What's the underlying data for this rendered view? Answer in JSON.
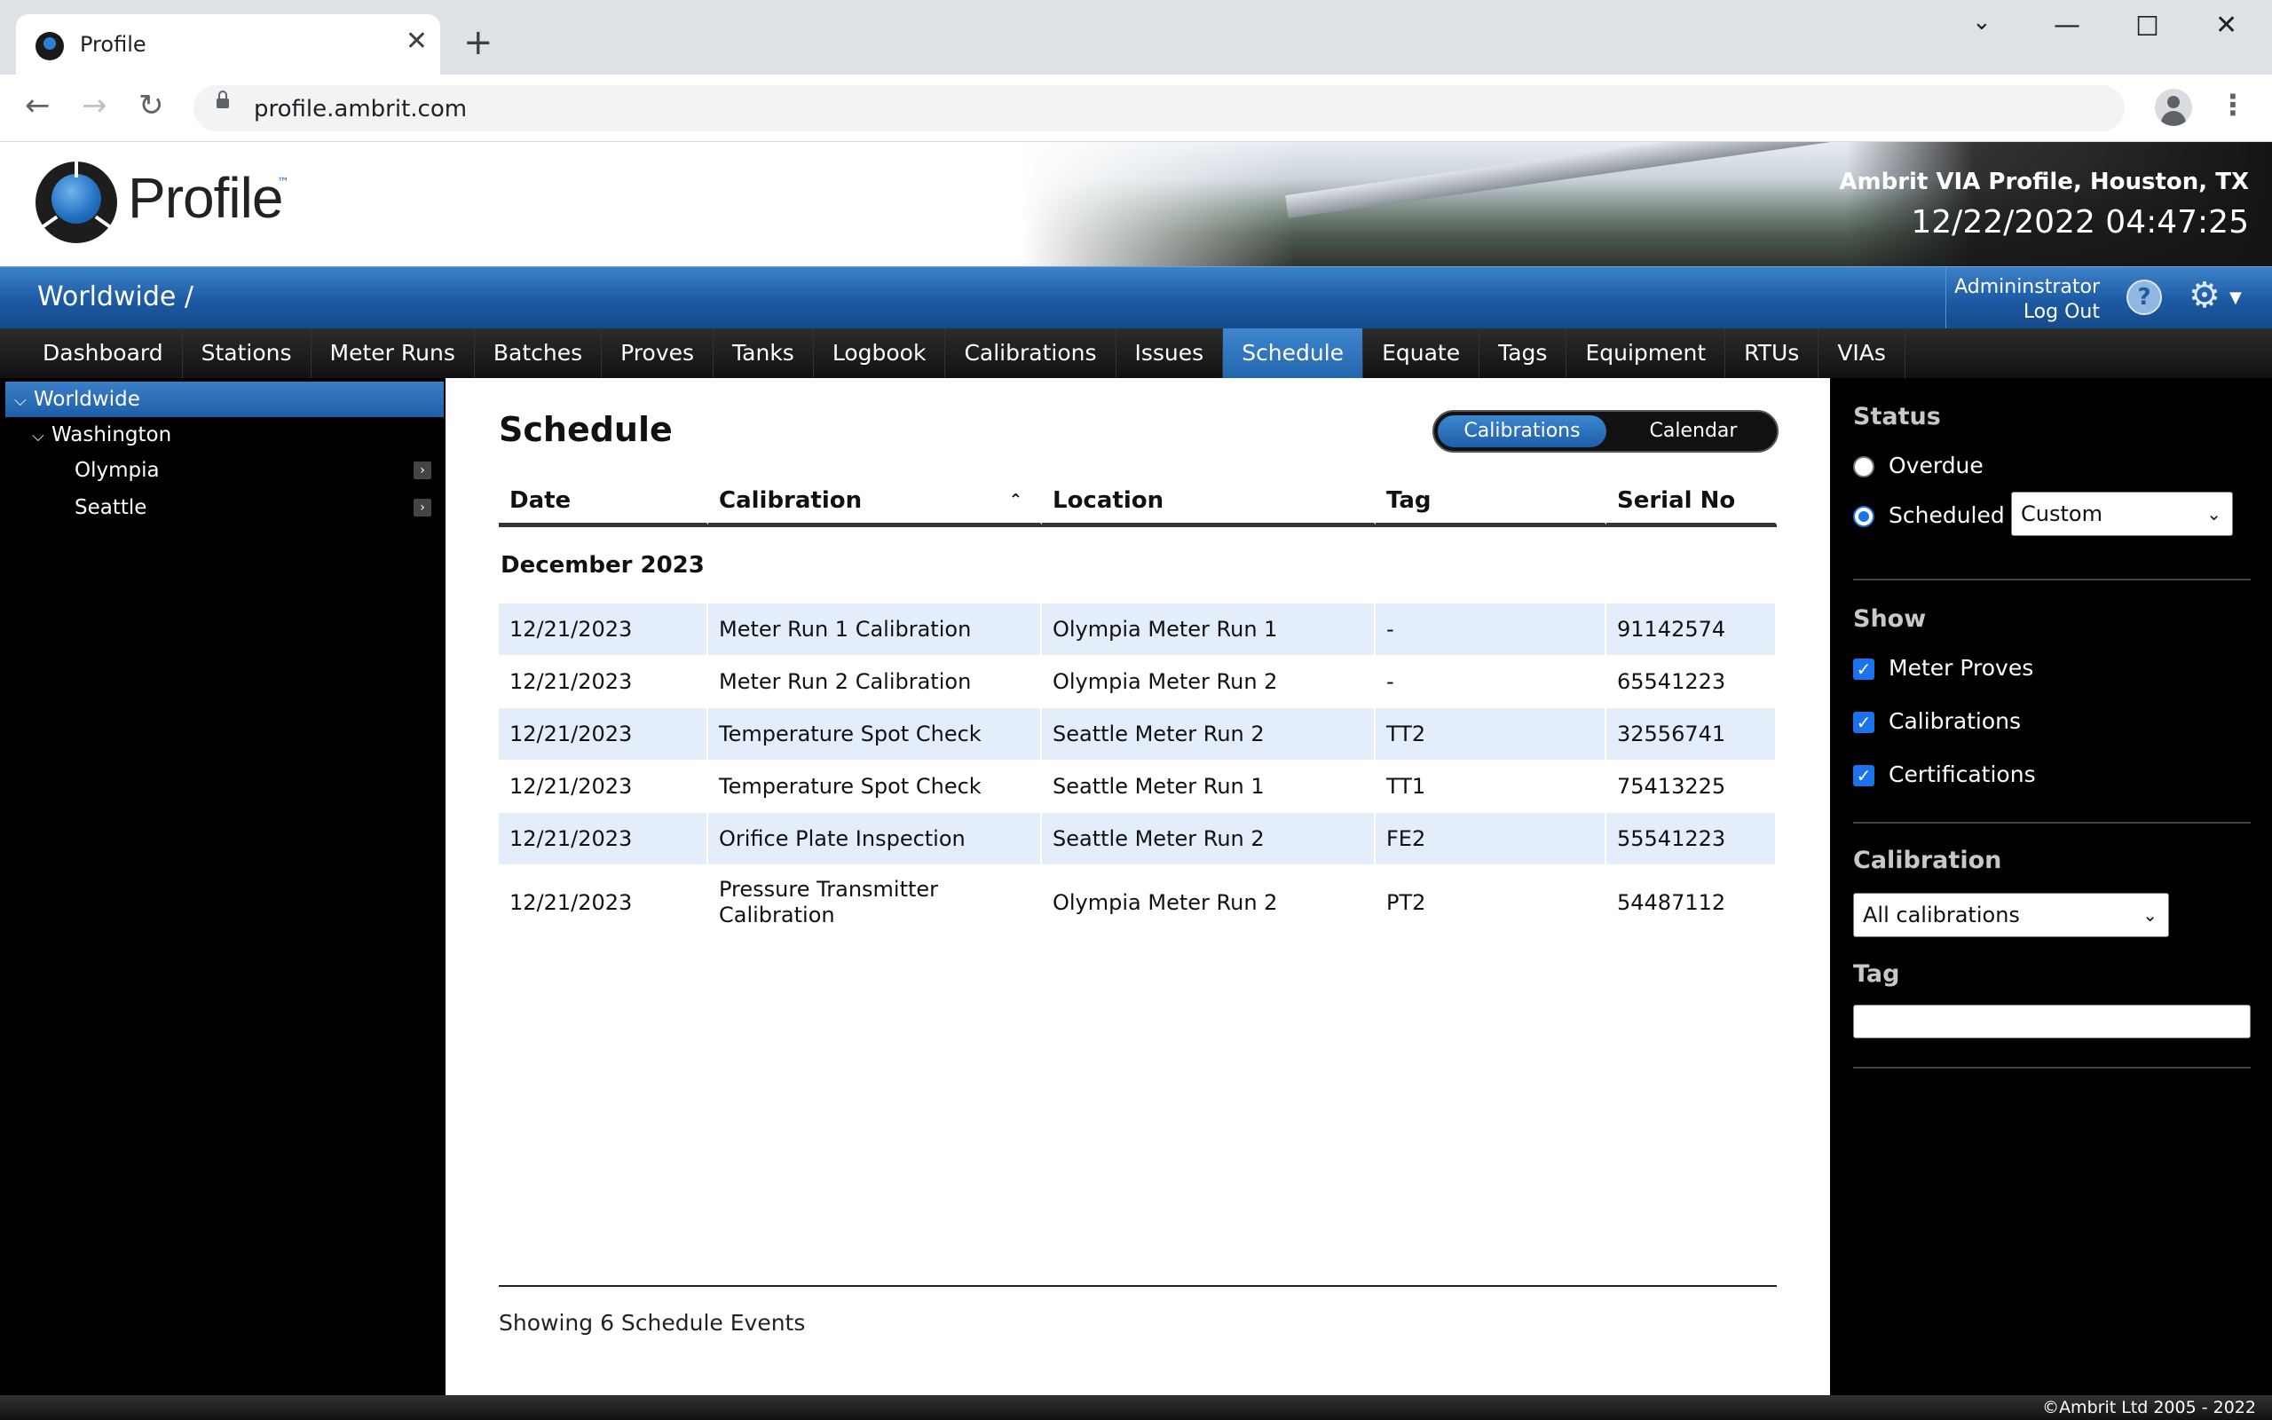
{
  "browser": {
    "tab_title": "Profile",
    "url": "profile.ambrit.com"
  },
  "header": {
    "logo_text": "Profile",
    "logo_tm": "™",
    "site_name": "Ambrit VIA Profile, Houston, TX",
    "datetime": "12/22/2022 04:47:25"
  },
  "bluebar": {
    "breadcrumb": "Worldwide /",
    "user": "Admininstrator",
    "logout": "Log Out",
    "help": "?"
  },
  "nav": {
    "items": [
      "Dashboard",
      "Stations",
      "Meter Runs",
      "Batches",
      "Proves",
      "Tanks",
      "Logbook",
      "Calibrations",
      "Issues",
      "Schedule",
      "Equate",
      "Tags",
      "Equipment",
      "RTUs",
      "VIAs"
    ],
    "active": "Schedule"
  },
  "tree": {
    "root": "Worldwide",
    "region": "Washington",
    "sites": [
      "Olympia",
      "Seattle"
    ]
  },
  "main": {
    "title": "Schedule",
    "toggle": {
      "calibrations": "Calibrations",
      "calendar": "Calendar"
    },
    "columns": {
      "date": "Date",
      "calibration": "Calibration",
      "location": "Location",
      "tag": "Tag",
      "serial": "Serial No"
    },
    "group": "December 2023",
    "rows": [
      {
        "date": "12/21/2023",
        "calibration": "Meter Run 1 Calibration",
        "location": "Olympia Meter Run 1",
        "tag": "-",
        "serial": "91142574"
      },
      {
        "date": "12/21/2023",
        "calibration": "Meter Run 2 Calibration",
        "location": "Olympia Meter Run 2",
        "tag": "-",
        "serial": "65541223"
      },
      {
        "date": "12/21/2023",
        "calibration": "Temperature Spot Check",
        "location": "Seattle Meter Run 2",
        "tag": "TT2",
        "serial": "32556741"
      },
      {
        "date": "12/21/2023",
        "calibration": "Temperature Spot Check",
        "location": "Seattle Meter Run 1",
        "tag": "TT1",
        "serial": "75413225"
      },
      {
        "date": "12/21/2023",
        "calibration": "Orifice Plate Inspection",
        "location": "Seattle Meter Run 2",
        "tag": "FE2",
        "serial": "55541223"
      },
      {
        "date": "12/21/2023",
        "calibration": "Pressure Transmitter Calibration",
        "location": "Olympia Meter Run 2",
        "tag": "PT2",
        "serial": "54487112"
      }
    ],
    "footer": "Showing 6 Schedule Events"
  },
  "filters": {
    "status_heading": "Status",
    "overdue_label": "Overdue",
    "scheduled_label": "Scheduled",
    "scheduled_range": "Custom",
    "show_heading": "Show",
    "show_items": [
      "Meter Proves",
      "Calibrations",
      "Certifications"
    ],
    "calibration_heading": "Calibration",
    "calibration_value": "All calibrations",
    "tag_heading": "Tag",
    "tag_value": ""
  },
  "footer": {
    "copyright": "©Ambrit Ltd 2005 - 2022"
  },
  "colors": {
    "accent": "#1f5ea8",
    "row_alt": "#e4eefa"
  }
}
